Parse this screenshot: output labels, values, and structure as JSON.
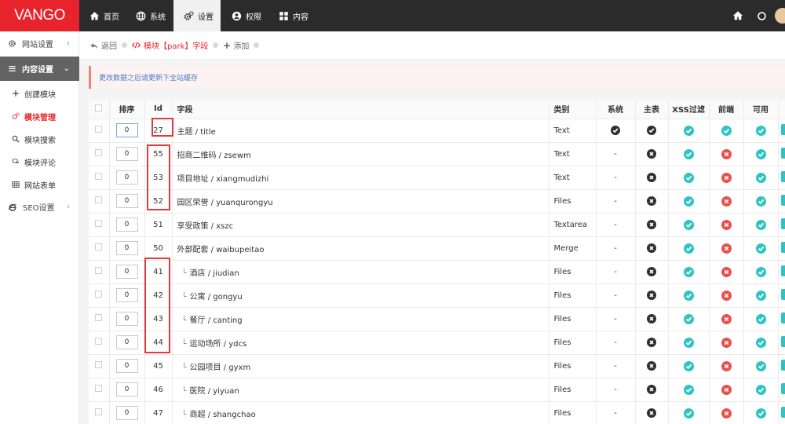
{
  "brand": {
    "logo": "VANGO"
  },
  "topnav": [
    {
      "label": "首页",
      "icon": "home-icon"
    },
    {
      "label": "系统",
      "icon": "globe-icon"
    },
    {
      "label": "设置",
      "icon": "gears-icon",
      "active": true
    },
    {
      "label": "权限",
      "icon": "user-circle-icon"
    },
    {
      "label": "内容",
      "icon": "grid-icon"
    }
  ],
  "sidebar": {
    "groups": [
      {
        "label": "网站设置",
        "icon": "gear-icon"
      },
      {
        "label": "内容设置",
        "icon": "menu-icon",
        "open": true
      },
      {
        "label": "SEO设置",
        "icon": "ie-icon"
      }
    ],
    "items": [
      {
        "label": "创建模块",
        "icon": "plus-icon"
      },
      {
        "label": "模块管理",
        "icon": "gears-icon",
        "active": true
      },
      {
        "label": "模块搜索",
        "icon": "search-icon"
      },
      {
        "label": "模块评论",
        "icon": "comments-icon"
      },
      {
        "label": "网站表单",
        "icon": "table-icon"
      }
    ]
  },
  "breadcrumb": {
    "back": "返回",
    "current": "模块【park】字段",
    "add": "添加"
  },
  "alert": {
    "text": "更改数据之后请更新下全站缓存"
  },
  "table": {
    "headers": {
      "sort": "排序",
      "id": "Id",
      "field": "字段",
      "type": "类别",
      "system": "系统",
      "main": "主表",
      "xss": "XSS过滤",
      "front": "前端",
      "available": "可用"
    },
    "rows": [
      {
        "sort": "0",
        "id": "27",
        "field": "主题 / title",
        "type": "Text",
        "system": "check",
        "main": "check",
        "xss": "yes",
        "front": "yes",
        "available": "yes",
        "child": false
      },
      {
        "sort": "0",
        "id": "55",
        "field": "招商二维码 / zsewm",
        "type": "Text",
        "system": "-",
        "main": "x",
        "xss": "yes",
        "front": "no",
        "available": "yes",
        "child": false
      },
      {
        "sort": "0",
        "id": "53",
        "field": "项目地址 / xiangmudizhi",
        "type": "Text",
        "system": "-",
        "main": "x",
        "xss": "yes",
        "front": "no",
        "available": "yes",
        "child": false
      },
      {
        "sort": "0",
        "id": "52",
        "field": "园区荣誉 / yuanqurongyu",
        "type": "Files",
        "system": "-",
        "main": "x",
        "xss": "yes",
        "front": "no",
        "available": "yes",
        "child": false
      },
      {
        "sort": "0",
        "id": "51",
        "field": "享受政策 / xszc",
        "type": "Textarea",
        "system": "-",
        "main": "x",
        "xss": "yes",
        "front": "no",
        "available": "yes",
        "child": false
      },
      {
        "sort": "0",
        "id": "50",
        "field": "外部配套 / waibupeitao",
        "type": "Merge",
        "system": "-",
        "main": "x",
        "xss": "yes",
        "front": "no",
        "available": "yes",
        "child": false
      },
      {
        "sort": "0",
        "id": "41",
        "field": "酒店 / jiudian",
        "type": "Files",
        "system": "-",
        "main": "x",
        "xss": "yes",
        "front": "no",
        "available": "yes",
        "child": true
      },
      {
        "sort": "0",
        "id": "42",
        "field": "公寓 / gongyu",
        "type": "Files",
        "system": "-",
        "main": "x",
        "xss": "yes",
        "front": "no",
        "available": "yes",
        "child": true
      },
      {
        "sort": "0",
        "id": "43",
        "field": "餐厅 / canting",
        "type": "Files",
        "system": "-",
        "main": "x",
        "xss": "yes",
        "front": "no",
        "available": "yes",
        "child": true
      },
      {
        "sort": "0",
        "id": "44",
        "field": "运动场所 / ydcs",
        "type": "Files",
        "system": "-",
        "main": "x",
        "xss": "yes",
        "front": "no",
        "available": "yes",
        "child": true
      },
      {
        "sort": "0",
        "id": "45",
        "field": "公园项目 / gyxm",
        "type": "Files",
        "system": "-",
        "main": "x",
        "xss": "yes",
        "front": "no",
        "available": "yes",
        "child": true
      },
      {
        "sort": "0",
        "id": "46",
        "field": "医院 / yiyuan",
        "type": "Files",
        "system": "-",
        "main": "x",
        "xss": "yes",
        "front": "no",
        "available": "yes",
        "child": true
      },
      {
        "sort": "0",
        "id": "47",
        "field": "商超 / shangchao",
        "type": "Files",
        "system": "-",
        "main": "x",
        "xss": "yes",
        "front": "no",
        "available": "yes",
        "child": true
      }
    ]
  },
  "colors": {
    "brand_red": "#e7242b",
    "teal": "#2ec4c4",
    "danger": "#ea4f4f",
    "highlight": "#e2393d"
  }
}
